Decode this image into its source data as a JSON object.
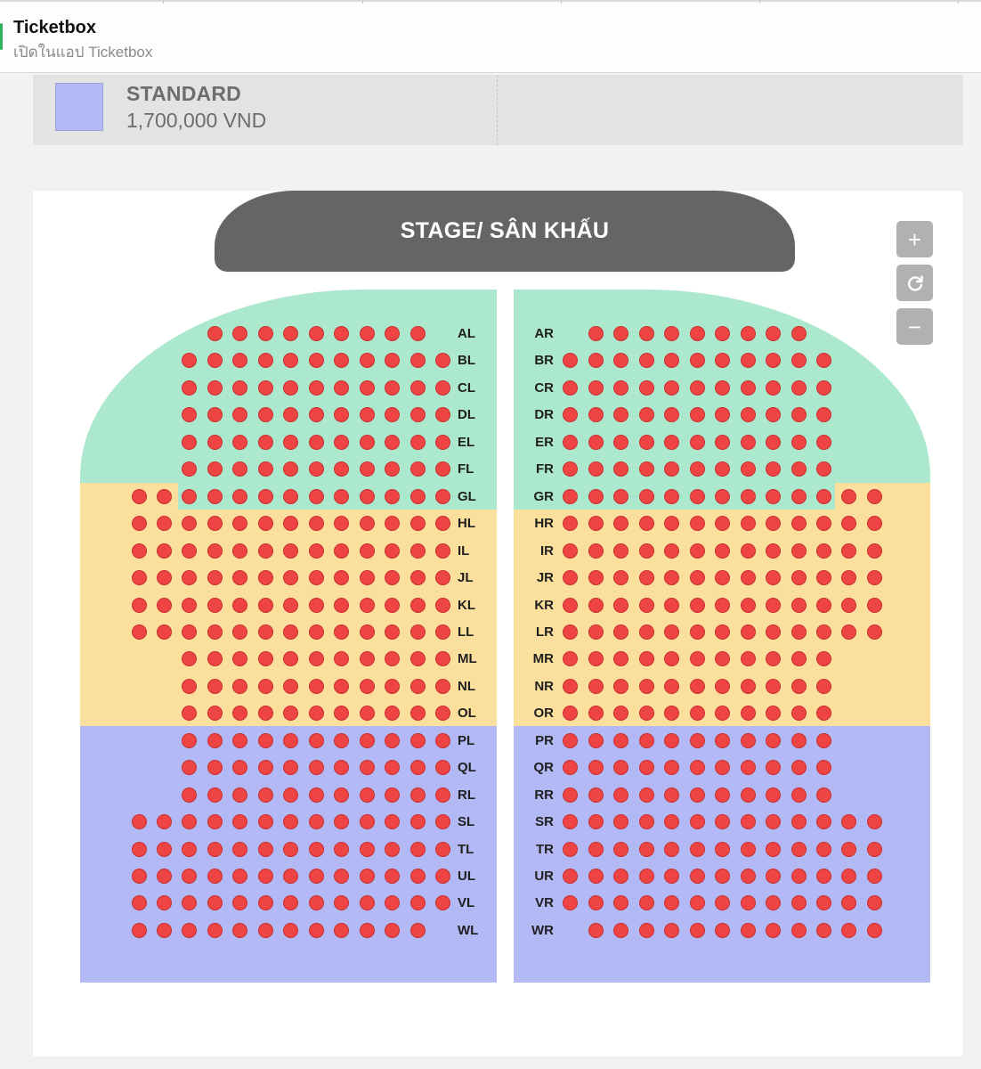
{
  "banner": {
    "app_name": "Ticketbox",
    "open_in_app": "เปิดในแอป Ticketbox"
  },
  "legend": {
    "tier_name": "STANDARD",
    "tier_price": "1,700,000 VND",
    "tier_color": "#b3b9f5"
  },
  "stage": {
    "label": "STAGE/ SÂN KHẤU"
  },
  "zoom_controls": {
    "zoom_in": "+",
    "zoom_out": "−",
    "reset_icon": "refresh-icon"
  },
  "colors": {
    "seat": "#ee4444",
    "green_zone": "#ace8cd",
    "yellow_zone": "#fbdf9c",
    "blue_zone": "#b3b9f5",
    "stage": "#656565"
  },
  "rows": [
    {
      "left": "AL",
      "right": "AR"
    },
    {
      "left": "BL",
      "right": "BR"
    },
    {
      "left": "CL",
      "right": "CR"
    },
    {
      "left": "DL",
      "right": "DR"
    },
    {
      "left": "EL",
      "right": "ER"
    },
    {
      "left": "FL",
      "right": "FR"
    },
    {
      "left": "GL",
      "right": "GR"
    },
    {
      "left": "HL",
      "right": "HR"
    },
    {
      "left": "IL",
      "right": "IR"
    },
    {
      "left": "JL",
      "right": "JR"
    },
    {
      "left": "KL",
      "right": "KR"
    },
    {
      "left": "LL",
      "right": "LR"
    },
    {
      "left": "ML",
      "right": "MR"
    },
    {
      "left": "NL",
      "right": "NR"
    },
    {
      "left": "OL",
      "right": "OR"
    },
    {
      "left": "PL",
      "right": "PR"
    },
    {
      "left": "QL",
      "right": "QR"
    },
    {
      "left": "RL",
      "right": "RR"
    },
    {
      "left": "SL",
      "right": "SR"
    },
    {
      "left": "TL",
      "right": "TR"
    },
    {
      "left": "UL",
      "right": "UR"
    },
    {
      "left": "VL",
      "right": "VR"
    },
    {
      "left": "WL",
      "right": "WR"
    }
  ]
}
